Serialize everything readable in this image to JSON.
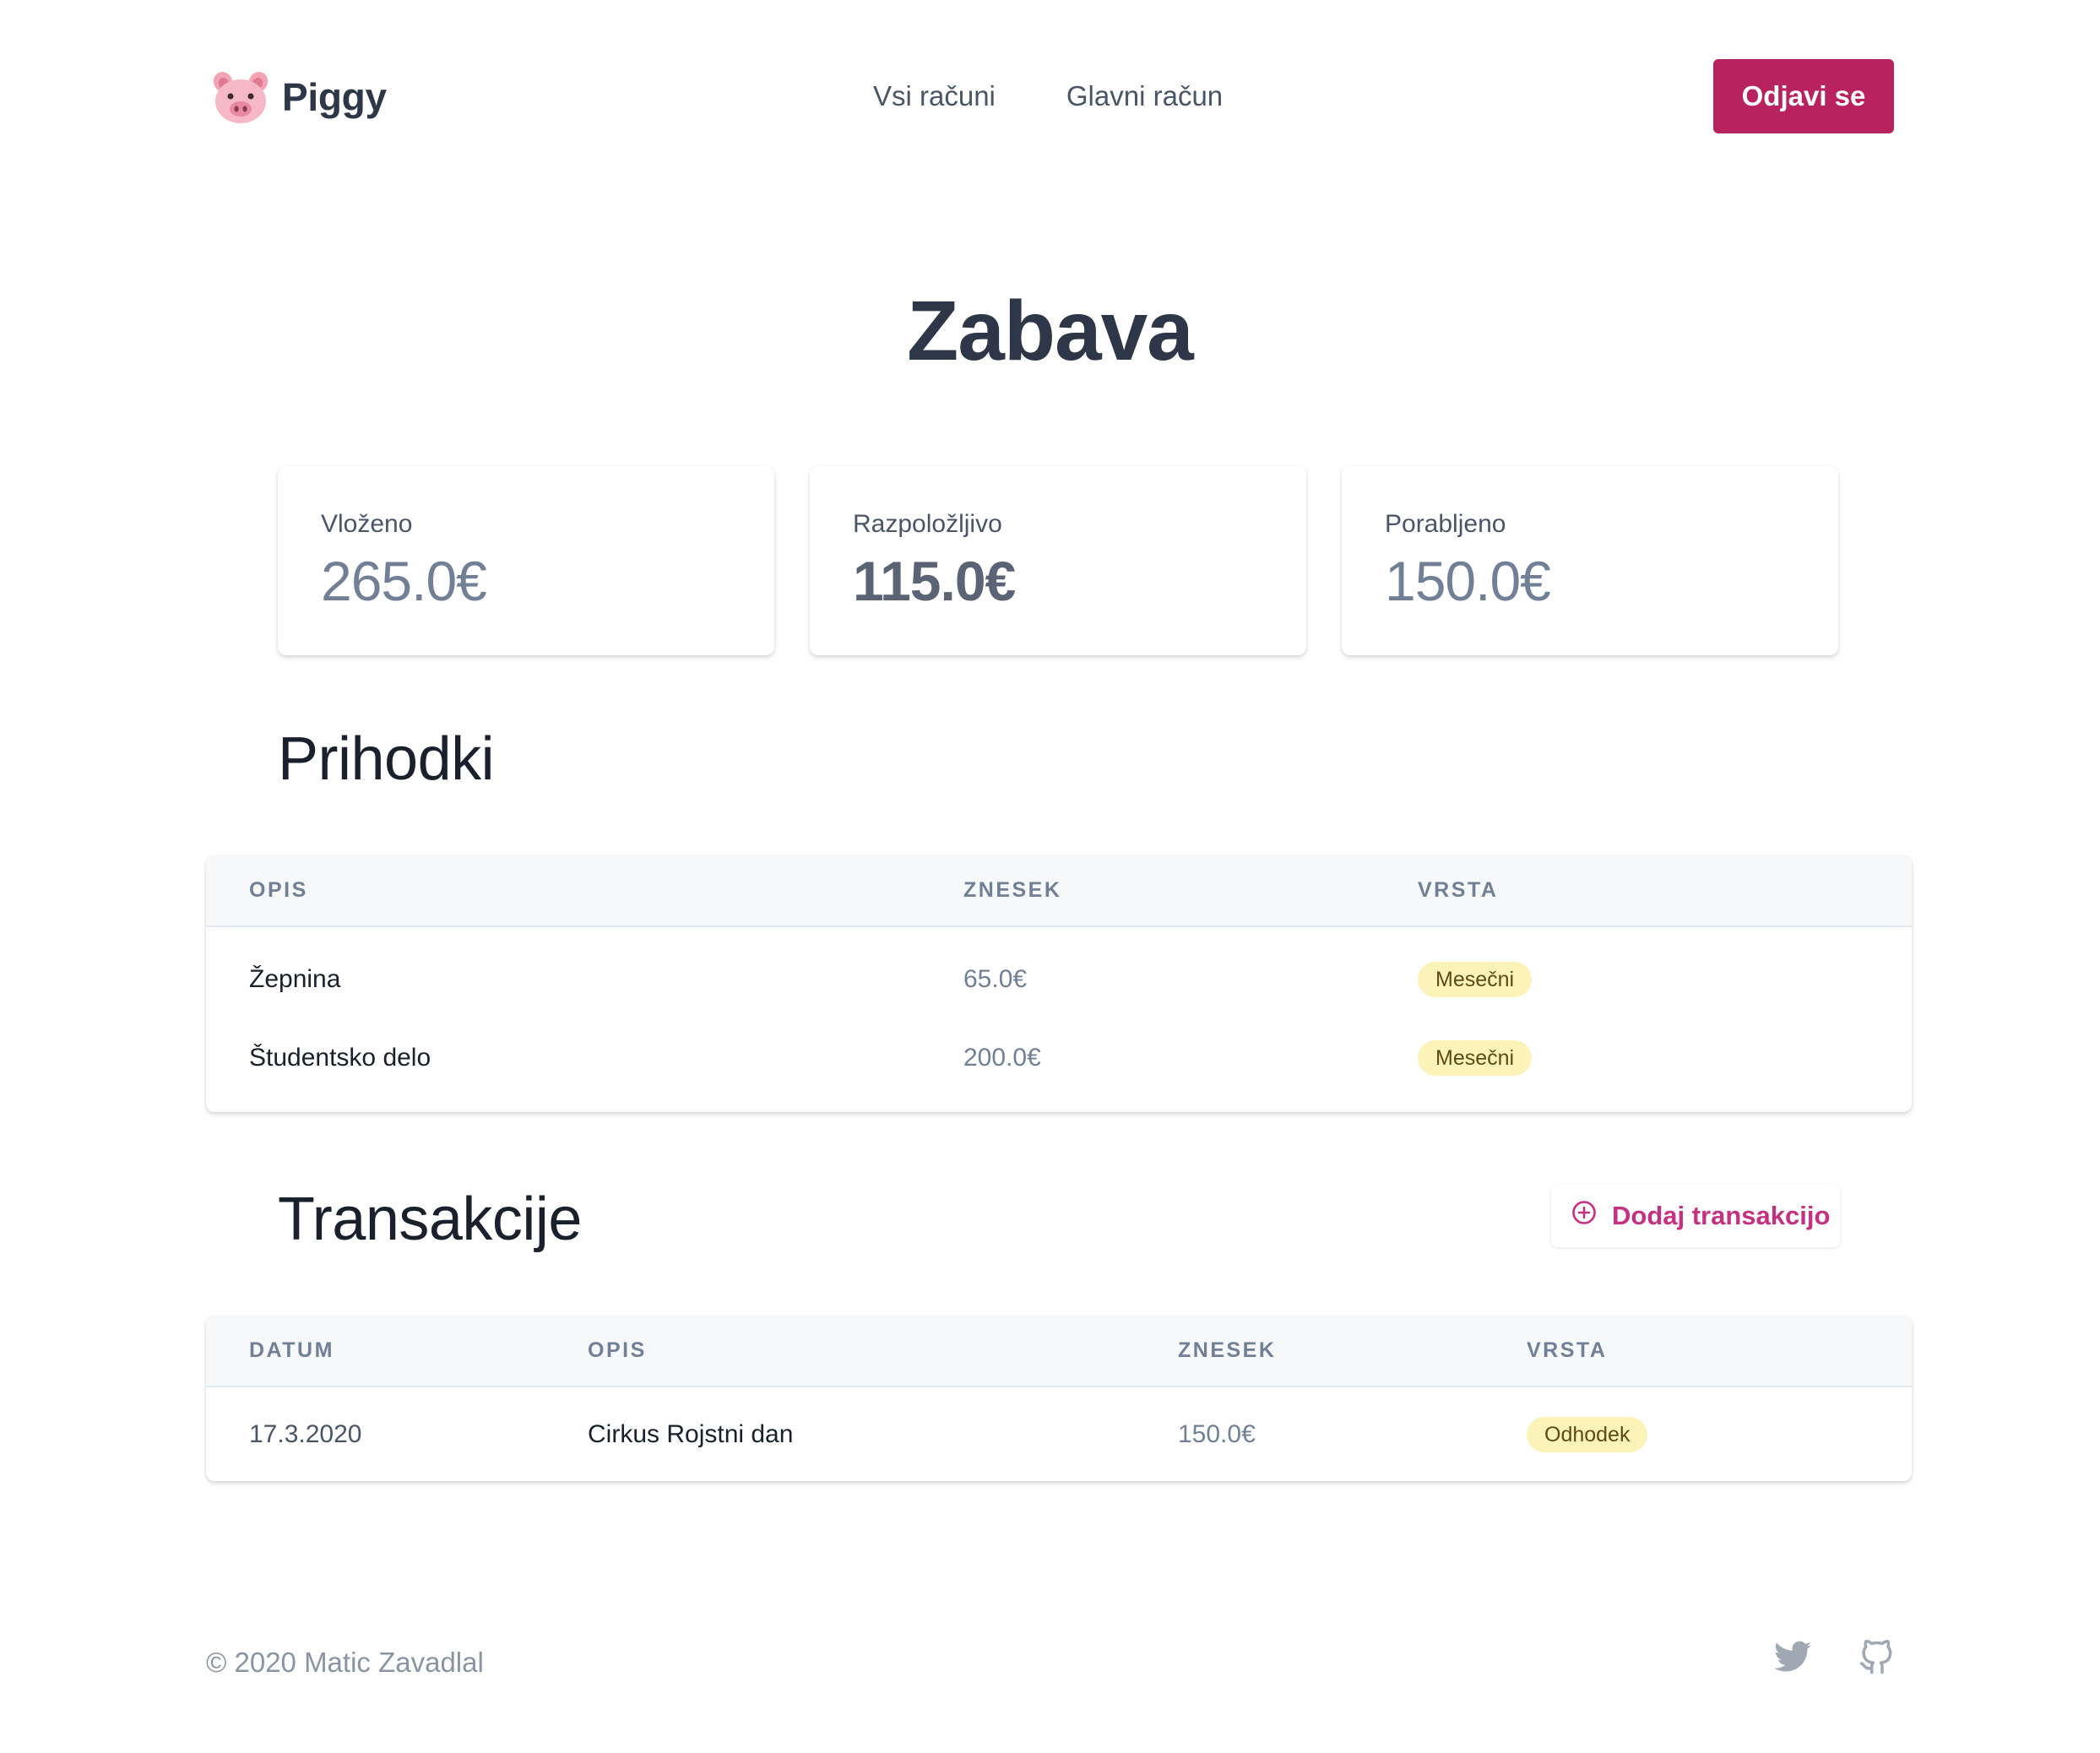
{
  "header": {
    "logo_text": "Piggy",
    "logo_icon": "pig-icon",
    "nav": [
      {
        "label": "Vsi računi"
      },
      {
        "label": "Glavni račun"
      }
    ],
    "logout_label": "Odjavi se"
  },
  "page": {
    "title": "Zabava"
  },
  "stats": [
    {
      "label": "Vloženo",
      "value": "265.0€"
    },
    {
      "label": "Razpoložljivo",
      "value": "115.0€"
    },
    {
      "label": "Porabljeno",
      "value": "150.0€"
    }
  ],
  "income": {
    "title": "Prihodki",
    "columns": [
      "OPIS",
      "ZNESEK",
      "VRSTA"
    ],
    "rows": [
      {
        "opis": "Žepnina",
        "znesek": "65.0€",
        "vrsta": "Mesečni"
      },
      {
        "opis": "Študentsko delo",
        "znesek": "200.0€",
        "vrsta": "Mesečni"
      }
    ]
  },
  "transactions": {
    "title": "Transakcije",
    "add_label": "Dodaj transakcijo",
    "add_icon": "plus-circle-icon",
    "columns": [
      "DATUM",
      "OPIS",
      "ZNESEK",
      "VRSTA"
    ],
    "rows": [
      {
        "datum": "17.3.2020",
        "opis": "Cirkus Rojstni dan",
        "znesek": "150.0€",
        "vrsta": "Odhodek"
      }
    ]
  },
  "footer": {
    "copyright": "© 2020 Matic Zavadlal",
    "icons": [
      "twitter-icon",
      "github-icon"
    ]
  },
  "colors": {
    "primary": "#b8225f",
    "accent_text": "#c53080",
    "badge_bg": "#fcf3b8",
    "badge_text": "#5f4a13"
  }
}
